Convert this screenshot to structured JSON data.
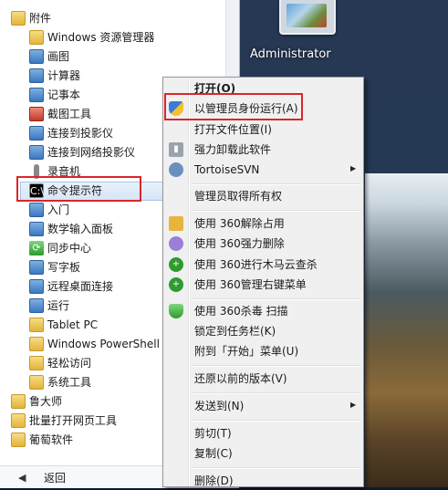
{
  "user": {
    "name": "Administrator"
  },
  "programs": {
    "items": [
      {
        "label": "附件",
        "icon": "folder-icon"
      },
      {
        "label": "Windows 资源管理器",
        "icon": "folder-explorer-icon"
      },
      {
        "label": "画图",
        "icon": "paint-icon"
      },
      {
        "label": "计算器",
        "icon": "calculator-icon"
      },
      {
        "label": "记事本",
        "icon": "notepad-icon"
      },
      {
        "label": "截图工具",
        "icon": "snipping-tool-icon"
      },
      {
        "label": "连接到投影仪",
        "icon": "projector-icon"
      },
      {
        "label": "连接到网络投影仪",
        "icon": "network-projector-icon"
      },
      {
        "label": "录音机",
        "icon": "microphone-icon"
      },
      {
        "label": "命令提示符",
        "icon": "command-prompt-icon"
      },
      {
        "label": "入门",
        "icon": "getting-started-icon"
      },
      {
        "label": "数学输入面板",
        "icon": "math-input-icon"
      },
      {
        "label": "同步中心",
        "icon": "sync-center-icon"
      },
      {
        "label": "写字板",
        "icon": "wordpad-icon"
      },
      {
        "label": "远程桌面连接",
        "icon": "remote-desktop-icon"
      },
      {
        "label": "运行",
        "icon": "run-icon"
      },
      {
        "label": "Tablet PC",
        "icon": "folder-icon"
      },
      {
        "label": "Windows PowerShell",
        "icon": "folder-icon"
      },
      {
        "label": "轻松访问",
        "icon": "folder-icon"
      },
      {
        "label": "系统工具",
        "icon": "folder-icon"
      },
      {
        "label": "鲁大师",
        "icon": "folder-icon"
      },
      {
        "label": "批量打开网页工具",
        "icon": "folder-icon"
      },
      {
        "label": "葡萄软件",
        "icon": "folder-icon"
      }
    ],
    "back_label": "返回"
  },
  "context_menu": {
    "items": [
      {
        "label": "打开(O)"
      },
      {
        "label": "以管理员身份运行(A)"
      },
      {
        "label": "打开文件位置(I)"
      },
      {
        "label": "强力卸载此软件"
      },
      {
        "label": "TortoiseSVN"
      },
      {
        "label": "管理员取得所有权"
      },
      {
        "label": "使用 360解除占用"
      },
      {
        "label": "使用 360强力删除"
      },
      {
        "label": "使用 360进行木马云查杀"
      },
      {
        "label": "使用 360管理右键菜单"
      },
      {
        "label": "使用 360杀毒 扫描"
      },
      {
        "label": "锁定到任务栏(K)"
      },
      {
        "label": "附到「开始」菜单(U)"
      },
      {
        "label": "还原以前的版本(V)"
      },
      {
        "label": "发送到(N)"
      },
      {
        "label": "剪切(T)"
      },
      {
        "label": "复制(C)"
      },
      {
        "label": "删除(D)"
      }
    ]
  },
  "colors": {
    "highlight_box": "#d9262a",
    "menu_bg": "#f0f0f0"
  }
}
